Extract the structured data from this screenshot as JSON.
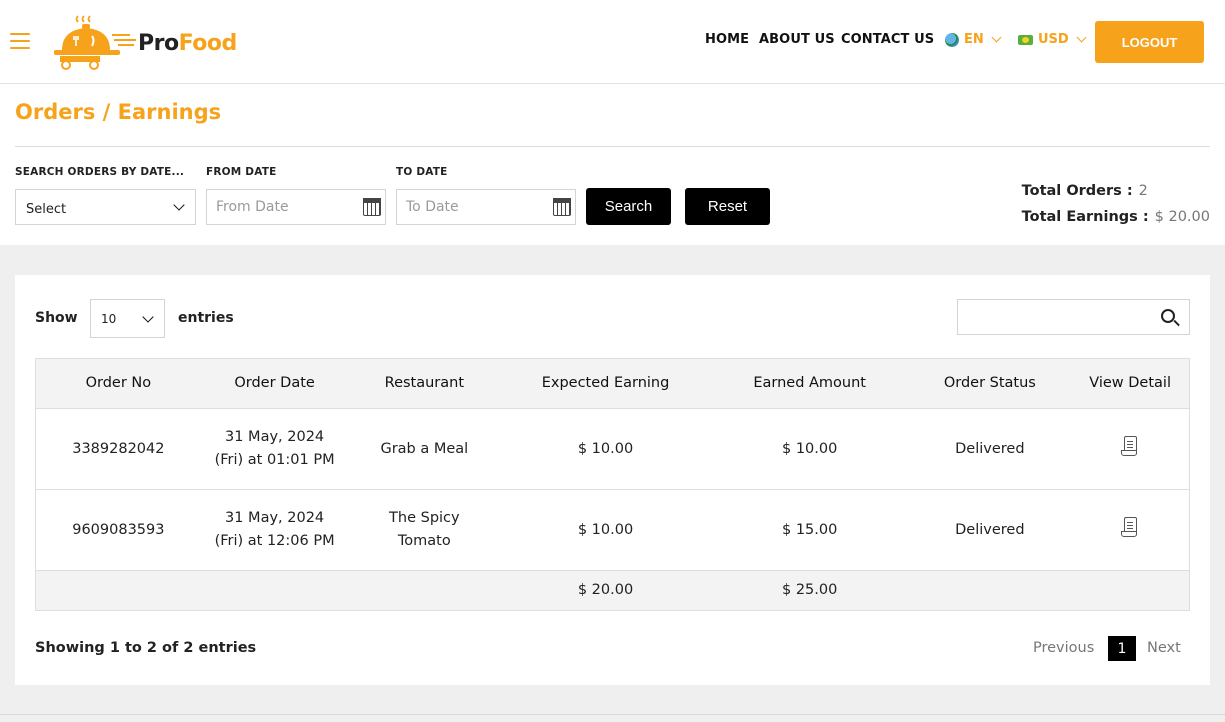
{
  "header": {
    "brand_pro": "Pro",
    "brand_food": "Food",
    "nav": {
      "home": "HOME",
      "about": "ABOUT US",
      "contact": "CONTACT US"
    },
    "language": "EN",
    "currency": "USD",
    "logout": "LOGOUT"
  },
  "page": {
    "title": "Orders / Earnings"
  },
  "filters": {
    "search_label": "SEARCH ORDERS BY DATE...",
    "select_value": "Select",
    "from_label": "FROM DATE",
    "from_placeholder": "From Date",
    "to_label": "TO DATE",
    "to_placeholder": "To Date",
    "search_button": "Search",
    "reset_button": "Reset"
  },
  "totals": {
    "orders_label": "Total Orders :",
    "orders_value": "2",
    "earnings_label": "Total Earnings :",
    "earnings_value": "$ 20.00"
  },
  "list": {
    "show_label": "Show",
    "entries_value": "10",
    "entries_label": "entries"
  },
  "table": {
    "headers": [
      "Order No",
      "Order Date",
      "Restaurant",
      "Expected Earning",
      "Earned Amount",
      "Order Status",
      "View Detail"
    ],
    "rows": [
      {
        "order_no": "3389282042",
        "date_line1": "31 May, 2024",
        "date_line2": "(Fri) at 01:01 PM",
        "restaurant": "Grab a Meal",
        "expected": "$ 10.00",
        "earned": "$ 10.00",
        "status": "Delivered"
      },
      {
        "order_no": "9609083593",
        "date_line1": "31 May, 2024",
        "date_line2": "(Fri) at 12:06 PM",
        "restaurant": "The Spicy Tomato",
        "expected": "$ 10.00",
        "earned": "$ 15.00",
        "status": "Delivered"
      }
    ],
    "footer": {
      "expected_total": "$ 20.00",
      "earned_total": "$ 25.00"
    }
  },
  "pagination": {
    "showing": "Showing 1 to 2 of 2 entries",
    "previous": "Previous",
    "current": "1",
    "next": "Next"
  },
  "colors": {
    "accent": "#f7a21b",
    "button_dark": "#000000",
    "panel_bg": "#efefef"
  }
}
